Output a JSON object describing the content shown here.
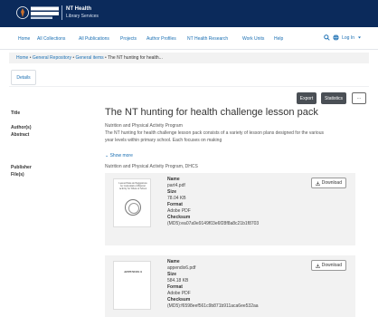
{
  "header": {
    "logo_text": "NORTHERN TERRITORY GOVERNMENT",
    "brand_title": "NT Health",
    "brand_subtitle": "Library Services"
  },
  "nav": {
    "items": [
      "Home",
      "All Collections",
      "All Publications",
      "Projects",
      "Author Profiles",
      "NT Health Research",
      "Work Units",
      "Help"
    ],
    "login_label": "Log In"
  },
  "breadcrumb": {
    "items": [
      "Home",
      "General Repository",
      "General items",
      "The NT hunting for health..."
    ]
  },
  "tabs": {
    "details": "Details"
  },
  "actions": {
    "export": "Export",
    "statistics": "Statistics",
    "more": "···"
  },
  "item": {
    "title": "The NT hunting for health challenge lesson pack",
    "labels": {
      "title": "Title",
      "authors": "Author(s)",
      "abstract": "Abstract",
      "publisher": "Publisher",
      "files": "File(s)"
    },
    "author": "Nutrition and Physical Activity Program",
    "abstract_line1": "The NT hunting for health challenge lesson pack consists of a variety of lesson plans designed for the various",
    "abstract_line2": "year levels within primary school. Each focuses on making",
    "show_more": "Show more",
    "publisher": "Nutrition and Physical Activity Program, DHCS"
  },
  "files": [
    {
      "thumb_text": "Lesson Plans and Suggestions for Curriculum of Physical Activity for Whole of School",
      "name_label": "Name",
      "name": "part4.pdf",
      "size_label": "Size",
      "size": "78.04 KB",
      "format_label": "Format",
      "format": "Adobe PDF",
      "checksum_label": "Checksum",
      "checksum": "(MD5):ea07a9e9149f03e6f28f8a8c21b1f8703",
      "download_label": "Download"
    },
    {
      "thumb_text": "APPENDIX 6",
      "name_label": "Name",
      "name": "appendix6.pdf",
      "size_label": "Size",
      "size": "584.18 KB",
      "format_label": "Format",
      "format": "Adobe PDF",
      "checksum_label": "Checksum",
      "checksum": "(MD5):f6598eef561c9b871b911aca6ee532aa",
      "download_label": "Download"
    }
  ]
}
